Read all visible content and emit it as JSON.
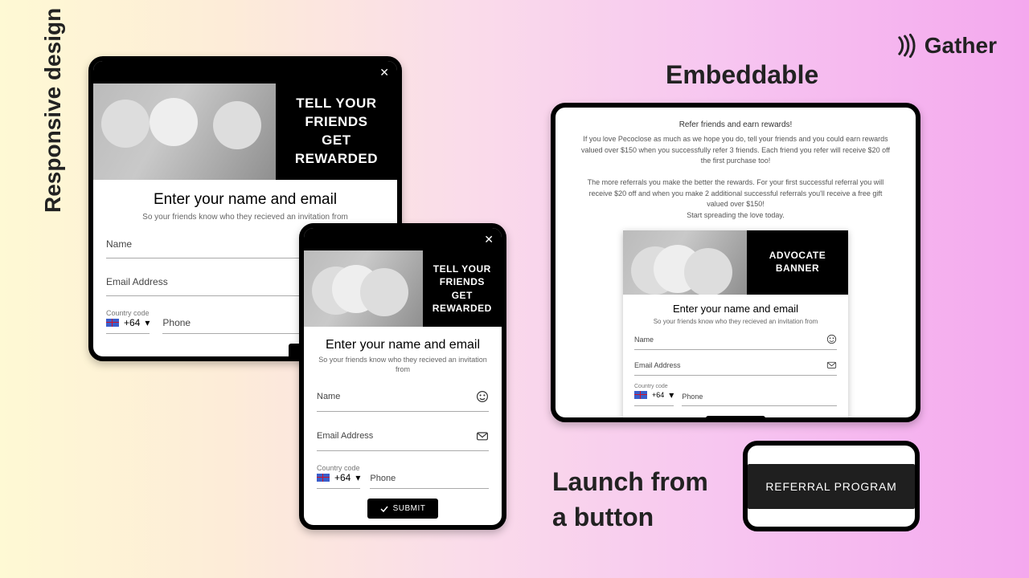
{
  "brand": {
    "name": "Gather"
  },
  "labels": {
    "responsive": "Responsive design",
    "embeddable": "Embeddable",
    "launch_line1": "Launch from",
    "launch_line2": "a button"
  },
  "modal": {
    "banner_line1": "TELL YOUR FRIENDS",
    "banner_line2": "GET REWARDED",
    "form_title": "Enter your name and email",
    "form_subtitle": "So your friends know who they recieved an invitation from",
    "name_label": "Name",
    "email_label": "Email Address",
    "phone_label": "Phone",
    "country_code_label": "Country code",
    "country_code": "+64",
    "submit": "SUBMIT"
  },
  "embed": {
    "heading": "Refer friends and earn rewards!",
    "p1": "If you love Pecoclose as much as we hope you do, tell your friends and you could earn rewards valued over $150 when you successfully refer 3 friends.  Each friend you refer will receive $20 off the first purchase too!",
    "p2": "The more referrals you make the better the rewards. For your first successful referral you will receive $20 off and when you make 2 additional successful referrals you'll receive a free gift valued over $150!",
    "p3": "Start spreading the love today.",
    "banner_line1": "ADVOCATE",
    "banner_line2": "BANNER"
  },
  "cta": {
    "referral_label": "REFERRAL PROGRAM"
  }
}
